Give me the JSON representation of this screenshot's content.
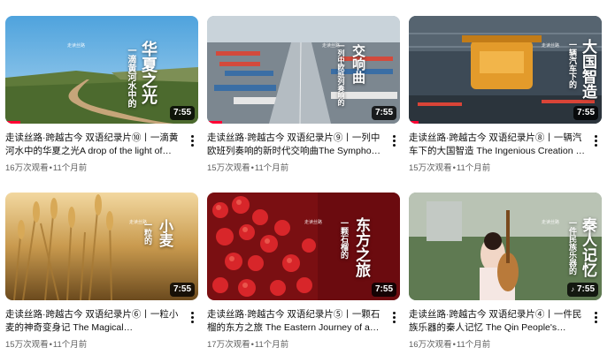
{
  "videos": [
    {
      "title": "走读丝路·跨越古今 双语纪录片⑩丨一滴黄河水中的华夏之光A drop of the light of Huaxia in the Yellow River",
      "overlay_text": "华夏之光",
      "overlay_sub": "一滴黄河水中的",
      "views": "16万次观看",
      "age": "11个月前",
      "duration": "7:55",
      "progress": 0.08
    },
    {
      "title": "走读丝路·跨越古今 双语纪录片⑨丨一列中欧班列奏响的新时代交响曲The Symphony of the New Era",
      "overlay_text": "交响曲",
      "overlay_sub": "一列中欧班列奏响的",
      "views": "15万次观看",
      "age": "11个月前",
      "duration": "7:55",
      "progress": 0.08
    },
    {
      "title": "走读丝路·跨越古今 双语纪录片⑧丨一辆汽车下的大国智造 The Ingenious Creation of a Great Power",
      "overlay_text": "大国智造",
      "overlay_sub": "一辆汽车下的",
      "views": "15万次观看",
      "age": "11个月前",
      "duration": "7:55",
      "progress": 0.05
    },
    {
      "title": "走读丝路·跨越古今 双语纪录片⑥丨一粒小麦的神奇变身记 The Magical Transformation of a Grain of Wheat",
      "overlay_text": "小麦",
      "overlay_sub": "一粒的",
      "views": "15万次观看",
      "age": "11个月前",
      "duration": "7:55",
      "progress": 0.0
    },
    {
      "title": "走读丝路·跨越古今 双语纪录片⑤丨一颗石榴的东方之旅 The Eastern Journey of a Pomegranate",
      "overlay_text": "东方之旅",
      "overlay_sub": "一颗石榴的",
      "views": "17万次观看",
      "age": "11个月前",
      "duration": "7:55",
      "progress": 0.0
    },
    {
      "title": "走读丝路·跨越古今 双语纪录片④丨一件民族乐器的秦人记忆 The Qin People's Memory in a Folk Instrument",
      "overlay_text": "秦人记忆",
      "overlay_sub": "一件民族乐器的",
      "views": "16万次观看",
      "age": "11个月前",
      "duration": "7:55",
      "playing": true,
      "progress": 0.0
    }
  ],
  "brand_text": "走读丝路",
  "colors": {
    "progress_red": "#ff0033",
    "meta_gray": "#606060",
    "title_black": "#0f0f0f"
  }
}
